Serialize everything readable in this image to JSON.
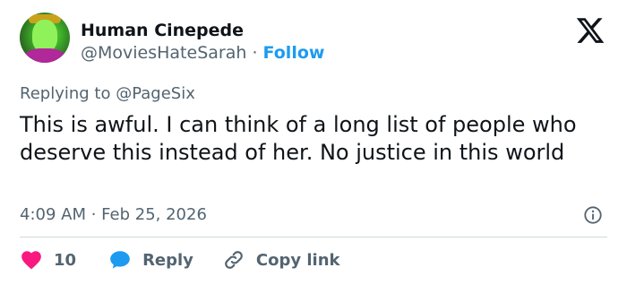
{
  "author": {
    "name": "Human Cinepede",
    "handle": "@MoviesHateSarah",
    "separator": "·",
    "follow_label": "Follow"
  },
  "reply_context": {
    "prefix": "Replying to ",
    "mention": "@PageSix"
  },
  "tweet": {
    "text": "This is awful. I can think of a long list of people who deserve this instead of her. No justice in this world",
    "timestamp": "4:09 AM · Feb 25, 2026"
  },
  "actions": {
    "like_count": "10",
    "reply_label": "Reply",
    "copy_label": "Copy link"
  },
  "icons": {
    "logo": "x-logo-icon",
    "info": "info-icon",
    "like": "heart-icon",
    "reply": "speech-bubble-icon",
    "copy": "link-icon"
  },
  "colors": {
    "accent": "#1d9bf0",
    "like": "#f91880",
    "secondary_text": "#536471",
    "primary_text": "#0f1419"
  }
}
